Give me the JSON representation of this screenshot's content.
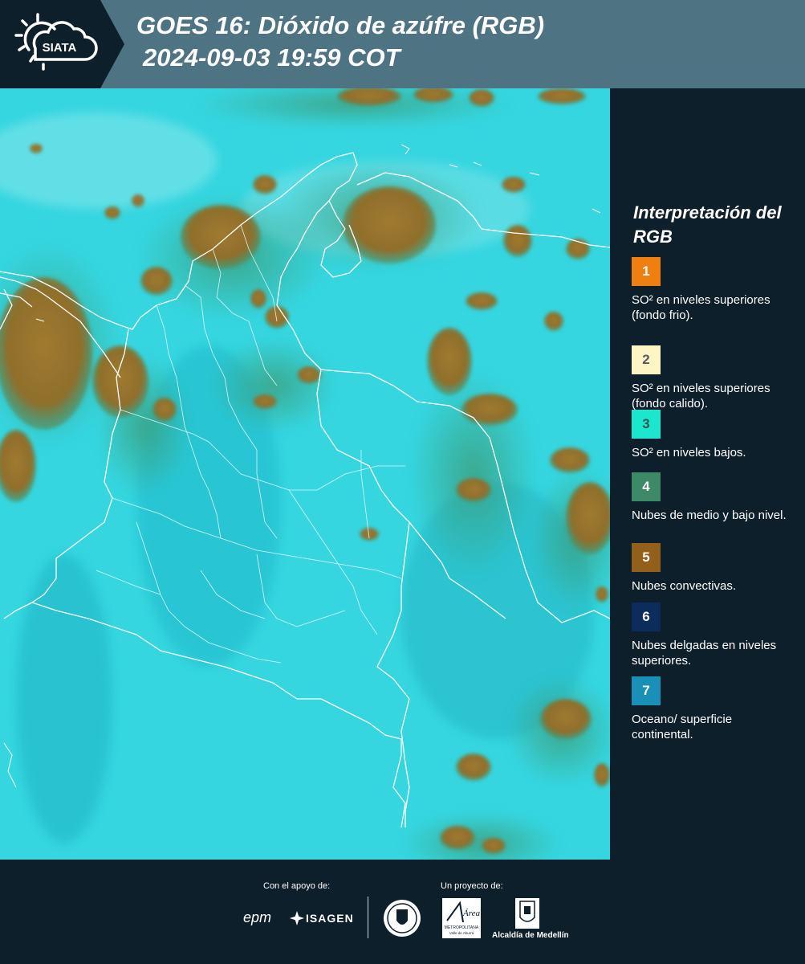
{
  "header": {
    "logo_text": "SIATA",
    "title_line1": "GOES 16: Dióxido de azúfre (RGB)",
    "title_line2": "2024-09-03 19:59 COT"
  },
  "legend": {
    "title": "Interpretación del RGB",
    "items": [
      {
        "number": "1",
        "color": "#f07f12",
        "number_color": "#ffffff",
        "text": "SO² en niveles superiores (fondo frio)."
      },
      {
        "number": "2",
        "color": "#fdf5c4",
        "number_color": "#5a5a5a",
        "text": "SO² en niveles superiores (fondo calido)."
      },
      {
        "number": "3",
        "color": "#1de6cf",
        "number_color": "#2a5a56",
        "text": "SO² en niveles bajos."
      },
      {
        "number": "4",
        "color": "#3d8a66",
        "number_color": "#ffffff",
        "text": "Nubes de medio y bajo nivel."
      },
      {
        "number": "5",
        "color": "#93601b",
        "number_color": "#ffffff",
        "text": "Nubes convectivas."
      },
      {
        "number": "6",
        "color": "#0c2c5c",
        "number_color": "#ffffff",
        "text": "Nubes delgadas en niveles superiores."
      },
      {
        "number": "7",
        "color": "#1a8fb8",
        "number_color": "#ffffff",
        "text": "Oceano/ superficie continental."
      }
    ]
  },
  "footer": {
    "support_label": "Con el apoyo de:",
    "project_label": "Un proyecto de:",
    "sponsor1": "epm",
    "sponsor2": "ISAGEN",
    "partner_area": "Área",
    "partner_area_sub": "METROPOLITANA",
    "partner_area_sub2": "Valle de Aburrá",
    "partner_alcaldia": "Alcaldía de Medellín"
  },
  "map": {
    "background_color": "#35d6e0",
    "cloud_color": "#a57a2a",
    "border_color": "#ffffff"
  }
}
